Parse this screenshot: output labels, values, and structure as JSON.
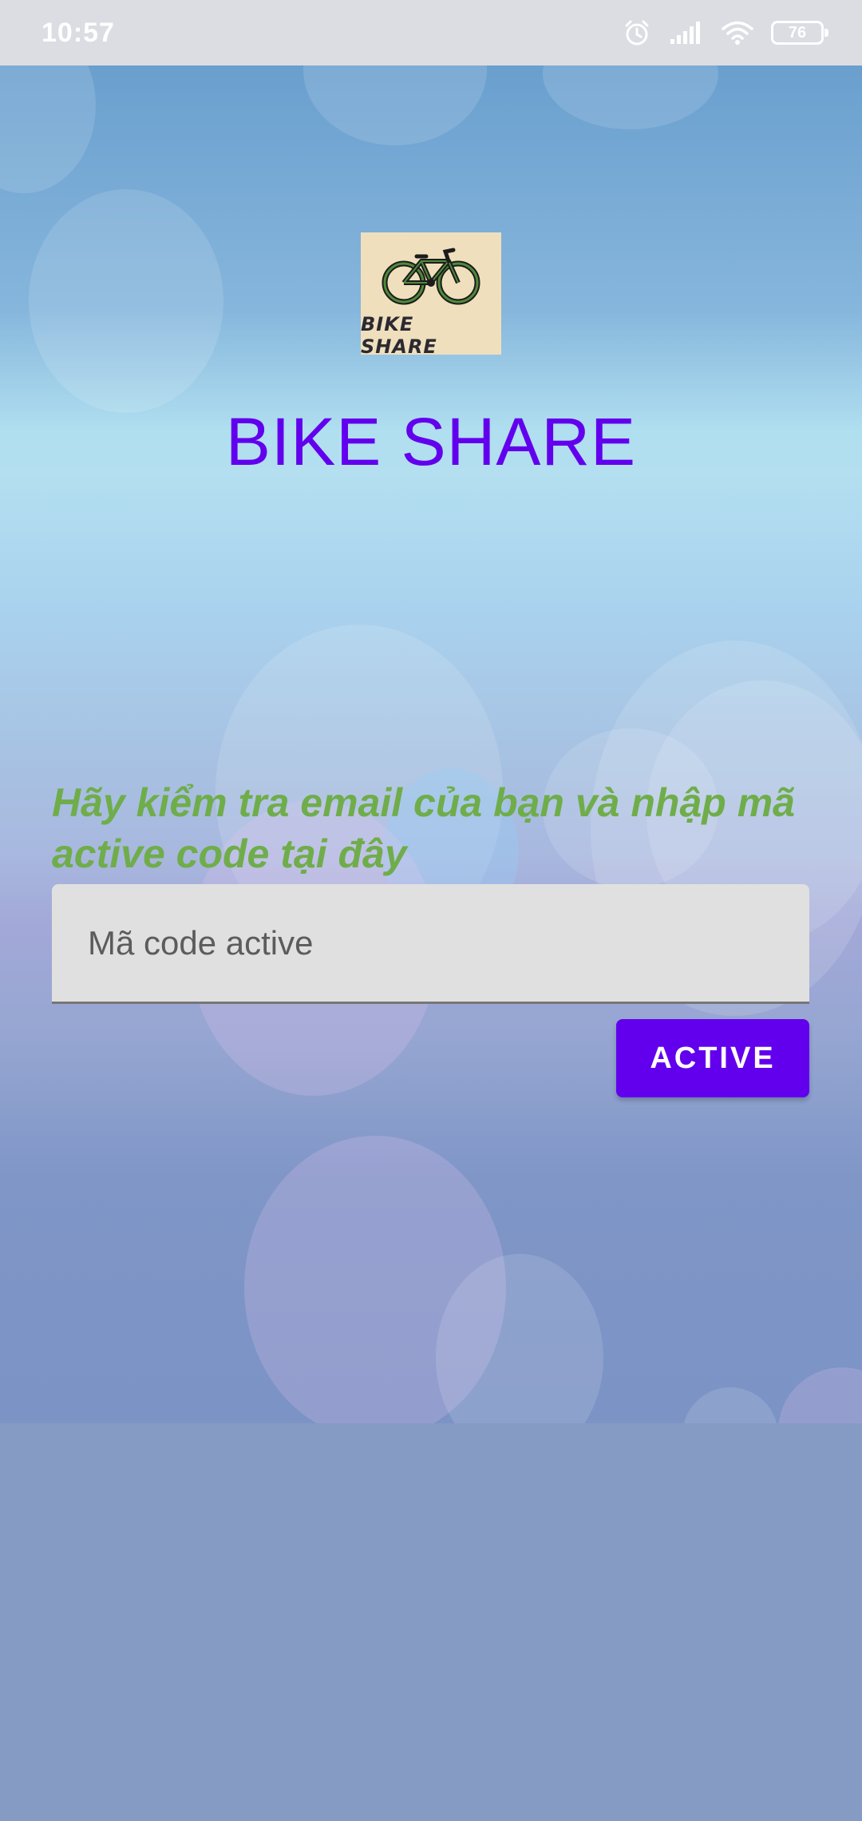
{
  "status_bar": {
    "time": "10:57",
    "battery": "76",
    "icons": [
      "alarm-icon",
      "signal-icon",
      "wifi-icon",
      "battery-icon"
    ]
  },
  "logo": {
    "text": "BIKE SHARE",
    "icon": "bicycle-icon"
  },
  "app_title": "BIKE SHARE",
  "instruction": "Hãy kiểm tra email của bạn và nhập mã active code tại đây",
  "active_code_input": {
    "placeholder": "Mã code active",
    "value": ""
  },
  "active_button": {
    "label": "ACTIVE"
  },
  "colors": {
    "primary": "#6200ee",
    "instruction_text": "#6fad4a",
    "status_bar": "#dcdde2",
    "logo_background": "#f0dfbd"
  }
}
